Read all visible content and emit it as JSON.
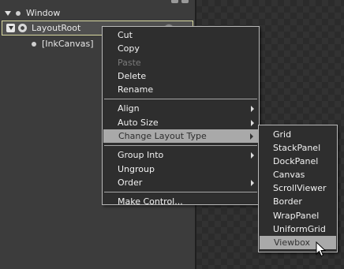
{
  "tree": {
    "window_label": "Window",
    "layoutroot_label": "LayoutRoot",
    "inkcanvas_label": "[InkCanvas]"
  },
  "context_menu": {
    "group1": [
      {
        "label": "Cut",
        "enabled": true
      },
      {
        "label": "Copy",
        "enabled": true
      },
      {
        "label": "Paste",
        "enabled": false
      },
      {
        "label": "Delete",
        "enabled": true
      },
      {
        "label": "Rename",
        "enabled": true
      }
    ],
    "group2": [
      {
        "label": "Align",
        "submenu": true
      },
      {
        "label": "Auto Size",
        "submenu": true
      },
      {
        "label": "Change Layout Type",
        "submenu": true,
        "highlighted": true
      }
    ],
    "group3": [
      {
        "label": "Group Into",
        "submenu": true
      },
      {
        "label": "Ungroup",
        "submenu": false
      },
      {
        "label": "Order",
        "submenu": true
      }
    ],
    "group4": [
      {
        "label": "Make Control...",
        "submenu": false
      }
    ]
  },
  "layout_submenu": {
    "items": [
      "Grid",
      "StackPanel",
      "DockPanel",
      "Canvas",
      "ScrollViewer",
      "Border",
      "WrapPanel",
      "UniformGrid",
      "Viewbox"
    ],
    "highlighted": "Viewbox"
  },
  "icons": {
    "expand": "chevron-down-icon",
    "visibility": "eye-icon",
    "submenu_arrow": "chevron-right-icon",
    "pointer": "mouse-pointer-icon"
  },
  "colors": {
    "menu_background": "#2e2e2e",
    "menu_border": "#b9b9b9",
    "highlight": "#a9a9a9",
    "selection_border": "#d9d9a0",
    "disabled_text": "#7a7a7a"
  }
}
